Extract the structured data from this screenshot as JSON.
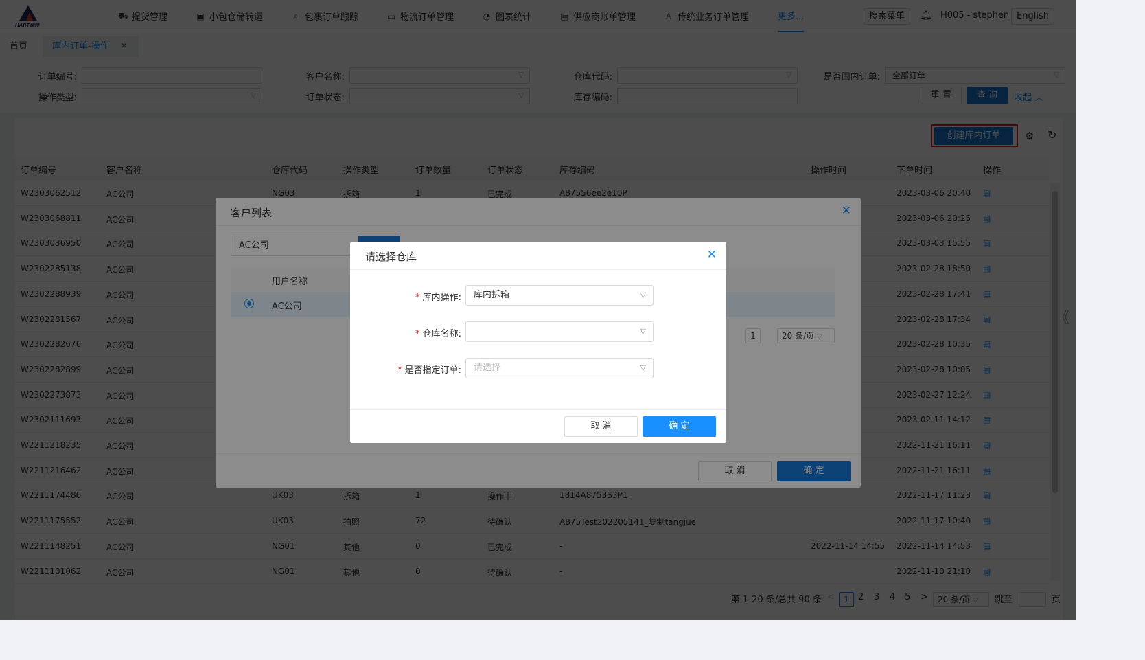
{
  "topbar": {
    "logo_text": "HART赫特",
    "nav": [
      {
        "label": "提货管理",
        "icon": "car-icon"
      },
      {
        "label": "小包仓储转运",
        "icon": "box-icon"
      },
      {
        "label": "包裹订单跟踪",
        "icon": "search-icon"
      },
      {
        "label": "物流订单管理",
        "icon": "folder-icon"
      },
      {
        "label": "图表统计",
        "icon": "pie-chart-icon"
      },
      {
        "label": "供应商账单管理",
        "icon": "bill-icon"
      },
      {
        "label": "传统业务订单管理",
        "icon": "org-icon"
      },
      {
        "label": "更多..."
      }
    ],
    "search_menu": "搜索菜单",
    "user": "H005 - stephen",
    "lang": "English"
  },
  "tabs": {
    "home": "首页",
    "current": "库内订单-操作"
  },
  "filter": {
    "order_no": "订单编号:",
    "customer": "客户名称:",
    "warehouse_code": "仓库代码:",
    "domestic": "是否国内订单:",
    "domestic_value": "全部订单",
    "op_type": "操作类型:",
    "order_status": "订单状态:",
    "stock_code": "库存编码:",
    "reset": "重 置",
    "query": "查 询",
    "collapse": "收起"
  },
  "toolbar": {
    "create": "创建库内订单"
  },
  "table": {
    "headers": [
      "订单编号",
      "客户名称",
      "仓库代码",
      "操作类型",
      "订单数量",
      "订单状态",
      "库存编码",
      "操作时间",
      "下单时间",
      "操作"
    ],
    "rows": [
      [
        "W2303062512",
        "AC公司",
        "NG03",
        "拆箱",
        "1",
        "已完成",
        "A87556ee2e10P",
        "",
        "2023-03-06 20:40"
      ],
      [
        "W2303068811",
        "AC公司",
        "",
        "",
        "",
        "",
        "",
        "",
        "2023-03-06 20:25"
      ],
      [
        "W2303036950",
        "AC公司",
        "",
        "",
        "",
        "",
        "",
        "",
        "2023-03-03 15:55"
      ],
      [
        "W2302285138",
        "AC公司",
        "",
        "",
        "",
        "",
        "",
        "",
        "2023-02-28 18:50"
      ],
      [
        "W2302288939",
        "AC公司",
        "",
        "",
        "",
        "",
        "",
        "",
        "2023-02-28 17:41"
      ],
      [
        "W2302281567",
        "AC公司",
        "",
        "",
        "",
        "",
        "",
        "",
        "2023-02-28 17:34"
      ],
      [
        "W2302282676",
        "AC公司",
        "",
        "",
        "",
        "",
        "",
        "",
        "2023-02-28 10:35"
      ],
      [
        "W2302282899",
        "AC公司",
        "",
        "",
        "",
        "",
        "",
        "",
        "2023-02-28 10:05"
      ],
      [
        "W2302273873",
        "AC公司",
        "",
        "",
        "",
        "",
        "",
        "",
        "2023-02-27 12:24"
      ],
      [
        "W2302111693",
        "AC公司",
        "",
        "",
        "",
        "",
        "",
        "",
        "2023-02-11 14:12"
      ],
      [
        "W2211218235",
        "AC公司",
        "",
        "",
        "",
        "",
        "",
        "",
        "2022-11-21 16:11"
      ],
      [
        "W2211216462",
        "AC公司",
        "",
        "",
        "",
        "",
        "",
        "",
        "2022-11-21 16:11"
      ],
      [
        "W2211174486",
        "AC公司",
        "UK03",
        "拆箱",
        "1",
        "操作中",
        "1814A8753S3P1",
        "",
        "2022-11-17 11:23"
      ],
      [
        "W2211175552",
        "AC公司",
        "UK03",
        "拍照",
        "72",
        "待确认",
        "A875Test202205141_复制tangjue",
        "",
        "2022-11-17 10:40"
      ],
      [
        "W2211148251",
        "AC公司",
        "NG01",
        "其他",
        "0",
        "已完成",
        "-",
        "2022-11-14 14:55",
        "2022-11-14 14:53"
      ],
      [
        "W2211101062",
        "AC公司",
        "NG01",
        "其他",
        "0",
        "待确认",
        "-",
        "",
        "2022-11-10 21:10"
      ]
    ]
  },
  "pagination": {
    "summary": "第 1-20 条/总共 90 条",
    "pages": [
      "1",
      "2",
      "3",
      "4",
      "5"
    ],
    "size": "20 条/页",
    "goto": "跳至",
    "page_unit": "页"
  },
  "customer_dialog": {
    "title": "客户列表",
    "search_value": "AC公司",
    "col_user": "用户名称",
    "row_user": "AC公司",
    "page": "1",
    "size": "20 条/页",
    "cancel": "取 消",
    "ok": "确 定"
  },
  "warehouse_dialog": {
    "title": "请选择仓库",
    "op_label": "库内操作:",
    "op_value": "库内拆箱",
    "wh_label": "仓库名称:",
    "wh_value": "",
    "spec_label": "是否指定订单:",
    "spec_placeholder": "请选择",
    "cancel": "取 消",
    "ok": "确 定"
  }
}
